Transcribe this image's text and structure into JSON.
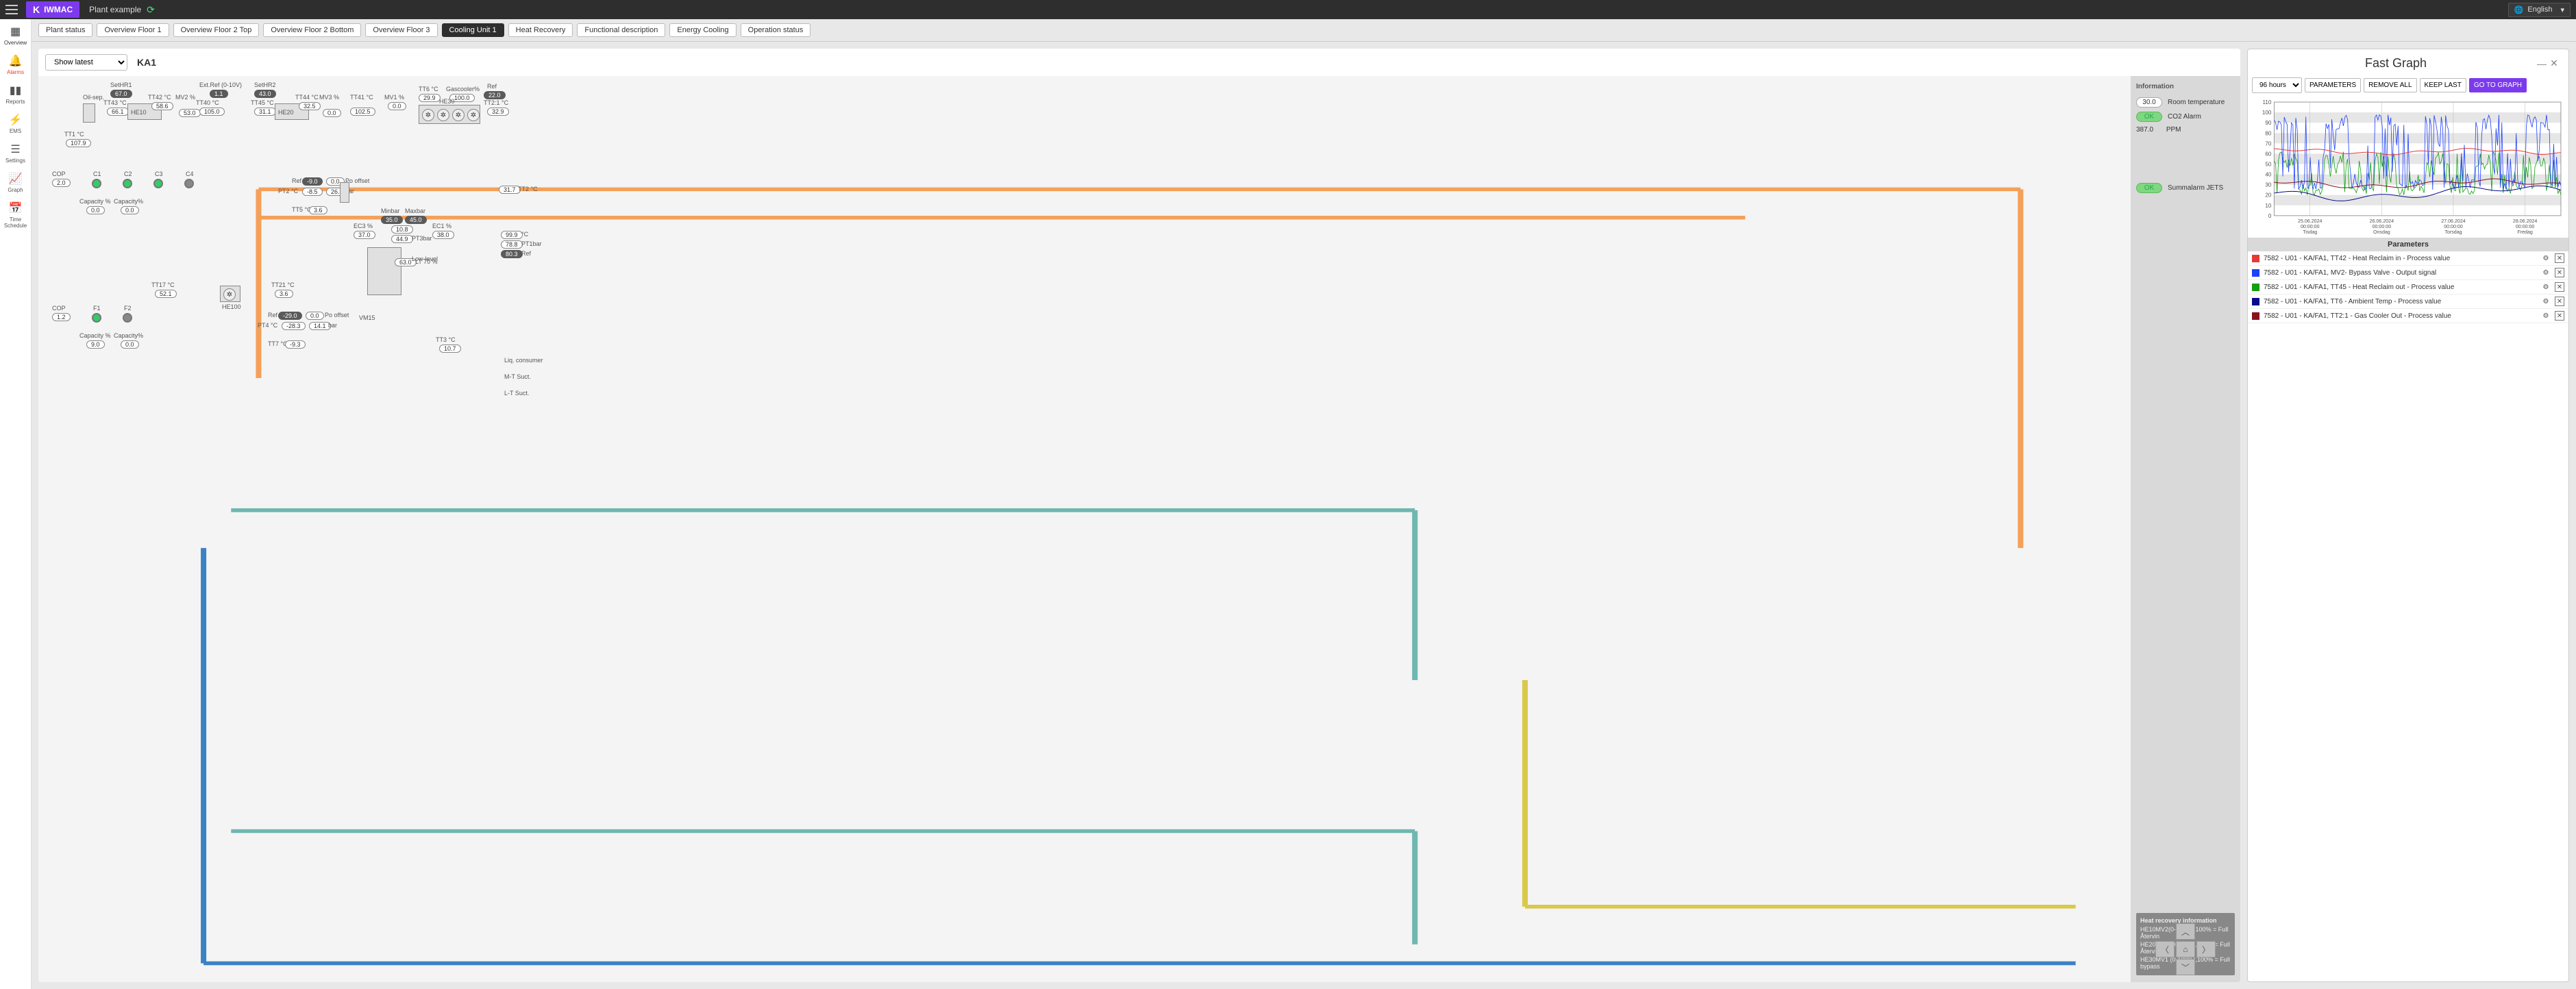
{
  "brand": "IWMAC",
  "plant_name": "Plant example",
  "language": "English",
  "sidebar": {
    "items": [
      {
        "label": "Overview"
      },
      {
        "label": "Alarms"
      },
      {
        "label": "Reports"
      },
      {
        "label": "EMS"
      },
      {
        "label": "Settings"
      },
      {
        "label": "Graph"
      },
      {
        "label": "Time Schedule"
      }
    ]
  },
  "tabs": [
    "Plant status",
    "Overview Floor 1",
    "Overview Floor 2 Top",
    "Overview Floor 2 Bottom",
    "Overview Floor 3",
    "Cooling Unit 1",
    "Heat Recovery",
    "Functional description",
    "Energy Cooling",
    "Operation status"
  ],
  "active_tab": "Cooling Unit 1",
  "show_latest": "Show latest",
  "unit_label": "KA1",
  "info_panel": {
    "header": "Information",
    "room_temp": {
      "value": "30.0",
      "label": "Room temperature"
    },
    "co2_alarm": {
      "value": "OK",
      "label": "CO2 Alarm"
    },
    "ppm": {
      "value": "387.0",
      "unit": "PPM"
    },
    "summ_alarm": {
      "value": "OK",
      "label": "Summalarm JETS"
    },
    "hr_header": "Heat recovery information",
    "hr_lines": [
      "HE10MV2(0-100%),100% = Full Återvin",
      "HE20MV3 (0-100%),100% = Full Återvin",
      "HE30MV1 (0-100%),100% = Full bypass"
    ]
  },
  "diagram": {
    "oil_sep": "Oil-sep.",
    "setHR1": {
      "label": "SetHR1",
      "value": "67.0"
    },
    "setHR2": {
      "label": "SetHR2",
      "value": "43.0"
    },
    "ext_ref": {
      "label": "Ext.Ref (0-10V)",
      "value": "1.1"
    },
    "TT43": {
      "label": "TT43 °C",
      "value": "66.1"
    },
    "TT42": {
      "label": "TT42 °C",
      "value": "58.6"
    },
    "TT45": {
      "label": "TT45 °C",
      "value": "31.1"
    },
    "TT44": {
      "label": "TT44 °C",
      "value": "32.5"
    },
    "TT41": {
      "label": "TT41 °C",
      "value": "102.5"
    },
    "TT40": {
      "label": "TT40 °C",
      "value": "105.0"
    },
    "MV2": {
      "label": "MV2 %",
      "value": "53.0"
    },
    "MV3": {
      "label": "MV3 %",
      "value": "0.0"
    },
    "MV1": {
      "label": "MV1 %",
      "value": "0.0"
    },
    "TT6": {
      "label": "TT6 °C",
      "value": "29.9"
    },
    "gascooler": {
      "label": "Gascooler%",
      "value": "100.0"
    },
    "ref1": {
      "label": "Ref",
      "value": "22.0"
    },
    "TT2_1": {
      "label": "TT2:1 °C",
      "value": "32.9"
    },
    "HE10": "HE10",
    "HE20": "HE20",
    "HE30": "HE30",
    "HE100": "HE100",
    "TT1": {
      "label": "TT1 °C",
      "value": "107.9"
    },
    "COP1": {
      "label": "COP",
      "value": "2.0"
    },
    "COP2": {
      "label": "COP",
      "value": "1.2"
    },
    "C1": "C1",
    "C2": "C2",
    "C3": "C3",
    "C4": "C4",
    "F1": "F1",
    "F2": "F2",
    "capacity1": {
      "label": "Capacity %",
      "value": "0.0"
    },
    "capacity2": {
      "label": "Capacity%",
      "value": "0.0"
    },
    "capacity3": {
      "label": "Capacity %",
      "value": "9.0"
    },
    "capacity4": {
      "label": "Capacity%",
      "value": "0.0"
    },
    "ref_po": {
      "label": "Ref",
      "value": "-9.0",
      "po": "0.0",
      "po_label": "Po offset"
    },
    "PT2": {
      "label": "PT2 °C",
      "value": "-8.5",
      "bar": "26.6",
      "bar_label": "bar"
    },
    "TT5": {
      "label": "TT5 °C",
      "value": "3.6"
    },
    "EC3": {
      "label": "EC3 %",
      "value": "37.0"
    },
    "EC1": {
      "label": "EC1 %",
      "value": "38.0"
    },
    "PT3": {
      "label": "PT3bar",
      "value1": "10.8",
      "value2": "44.9"
    },
    "minbar": {
      "label": "Minbar",
      "value": "35.0"
    },
    "maxbar": {
      "label": "Maxbar",
      "value": "45.0"
    },
    "lowlevel": {
      "label": "Low-level",
      "value": "63.0"
    },
    "LT70": "LT 70 %",
    "TT2": {
      "label": "TT2 °C",
      "value": "31.7"
    },
    "PT1_a": {
      "label": "°C",
      "value": "99.9"
    },
    "PT1_b": {
      "label": "PT1bar",
      "value": "78.8"
    },
    "PT1_c": {
      "label": "Ref",
      "value": "80.3"
    },
    "TT17": {
      "label": "TT17 °C",
      "value": "52.1"
    },
    "TT21": {
      "label": "TT21 °C",
      "value": "3.6"
    },
    "ref2": {
      "label": "Ref",
      "value": "-29.0",
      "po": "0.0",
      "po_label": "Po offset"
    },
    "PT4": {
      "label": "PT4 °C",
      "value": "-28.3",
      "bar": "14.1",
      "bar_label": "bar"
    },
    "TT7": {
      "label": "TT7 °C",
      "value": "-9.3"
    },
    "TT3": {
      "label": "TT3 °C",
      "value": "10.7"
    },
    "VM15": "VM15",
    "liq": "Liq. consumer",
    "mt": "M-T Suct.",
    "lt": "L-T Suct."
  },
  "fastgraph": {
    "title": "Fast Graph",
    "range": "96 hours",
    "buttons": {
      "parameters": "PARAMETERS",
      "remove_all": "REMOVE ALL",
      "keep_last": "KEEP LAST",
      "go": "GO TO GRAPH"
    },
    "params_header": "Parameters",
    "params": [
      {
        "color": "#e53935",
        "label": "7582 - U01 - KA/FA1, TT42 - Heat Reclaim in - Process value"
      },
      {
        "color": "#1e40ff",
        "label": "7582 - U01 - KA/FA1, MV2- Bypass Valve - Output signal"
      },
      {
        "color": "#12a012",
        "label": "7582 - U01 - KA/FA1, TT45 - Heat Reclaim out - Process value"
      },
      {
        "color": "#0a0a8a",
        "label": "7582 - U01 - KA/FA1, TT6 - Ambient Temp - Process value"
      },
      {
        "color": "#8a1020",
        "label": "7582 - U01 - KA/FA1, TT2:1 - Gas Cooler Out - Process value"
      }
    ]
  },
  "chart_data": {
    "type": "line",
    "title": "",
    "ylim": [
      0,
      110
    ],
    "yticks": [
      0,
      10,
      20,
      30,
      40,
      50,
      60,
      70,
      80,
      90,
      100,
      110
    ],
    "x_categories": [
      "25.06.2024\n00:00:00\nTisdag",
      "26.06.2024\n00:00:00\nOnsdag",
      "27.06.2024\n00:00:00\nTorsdag",
      "28.06.2024\n00:00:00\nFredag"
    ],
    "series": [
      {
        "name": "TT42 Heat Reclaim in",
        "color": "#e53935",
        "values": [
          62,
          63,
          62,
          64,
          63,
          62,
          61,
          63,
          62,
          63
        ]
      },
      {
        "name": "MV2 Bypass Valve",
        "color": "#1e40ff",
        "values_range": [
          20,
          100
        ],
        "pattern": "spiky"
      },
      {
        "name": "TT45 Heat Reclaim out",
        "color": "#12a012",
        "values_range": [
          20,
          65
        ],
        "pattern": "spiky"
      },
      {
        "name": "TT6 Ambient Temp",
        "color": "#0a0a8a",
        "values": [
          22,
          20,
          18,
          25,
          22,
          19,
          26,
          23,
          20,
          27
        ]
      },
      {
        "name": "TT2:1 Gas Cooler Out",
        "color": "#8a1020",
        "values": [
          30,
          32,
          30,
          33,
          31,
          30,
          34,
          32,
          30,
          33
        ]
      }
    ]
  }
}
